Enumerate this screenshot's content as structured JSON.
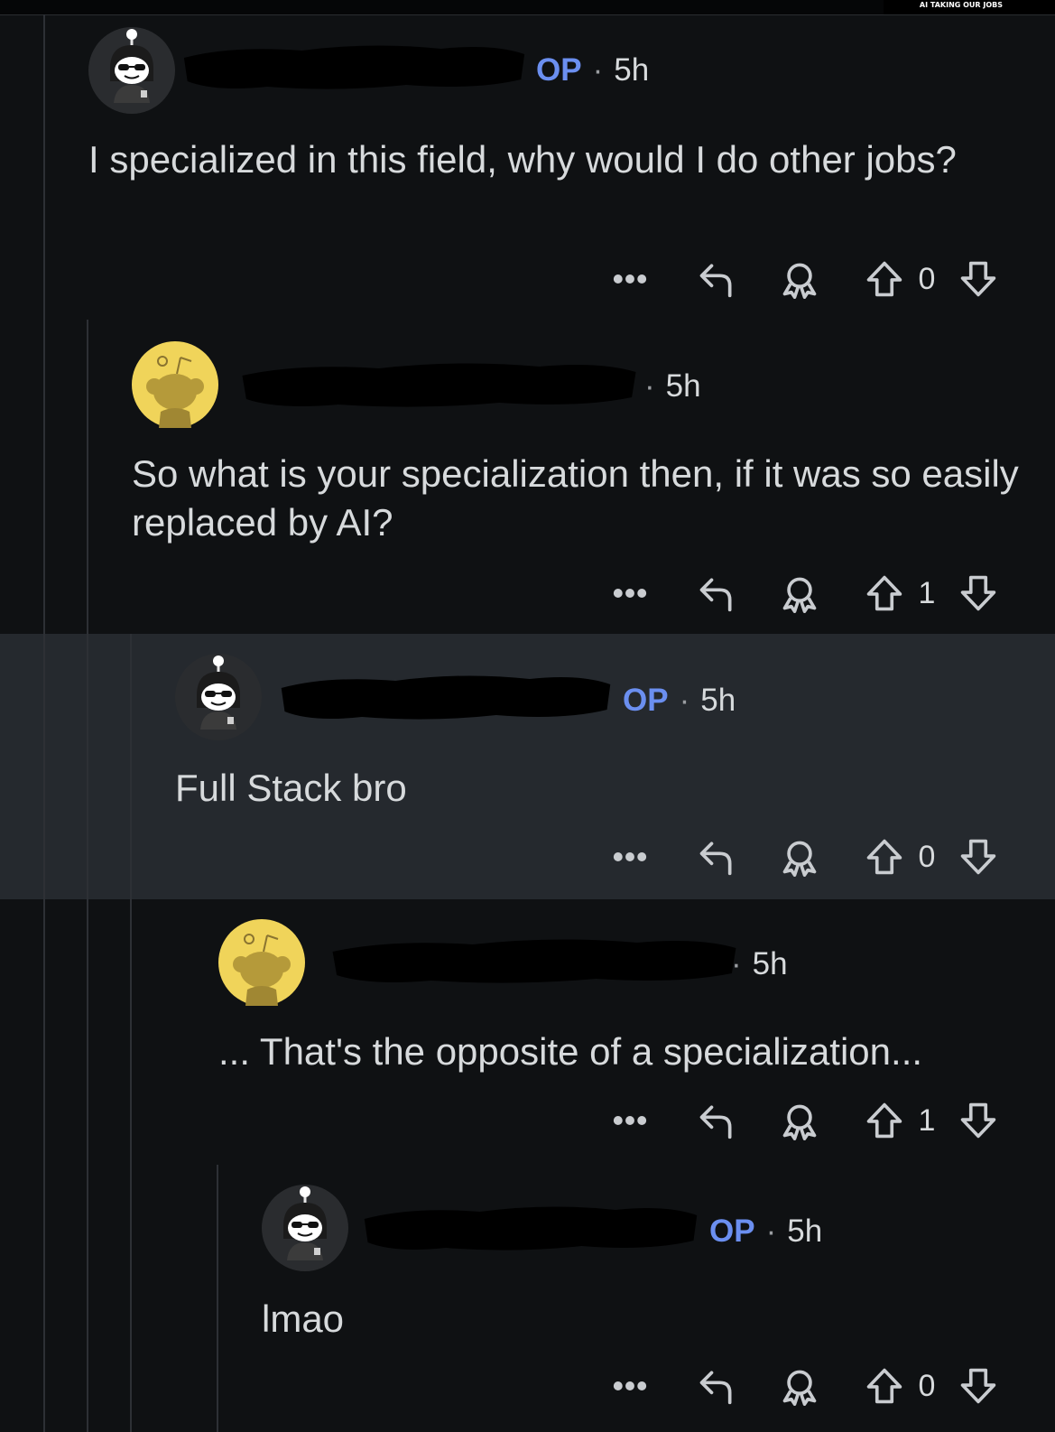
{
  "watermark": {
    "text": "AI TAKING OUR JOBS"
  },
  "comments": [
    {
      "op": "OP",
      "dot": "·",
      "time": "5h",
      "body": "I specialized in this field, why would I do other jobs?",
      "votes": "0"
    },
    {
      "dot": "·",
      "time": "5h",
      "body": "So what is your specialization then, if it was so easily replaced by AI?",
      "votes": "1"
    },
    {
      "op": "OP",
      "dot": "·",
      "time": "5h",
      "body": "Full Stack bro",
      "votes": "0"
    },
    {
      "dot": "·",
      "time": "5h",
      "body": "... That's the opposite of a specialization...",
      "votes": "1"
    },
    {
      "op": "OP",
      "dot": "·",
      "time": "5h",
      "body": "lmao",
      "votes": "0"
    }
  ],
  "colors": {
    "background": "#0f1113",
    "highlight": "#25292e",
    "op_label": "#6b8ff0",
    "text": "#d7dadc",
    "icon": "#c9ccd0",
    "snoo_yellow": "#f0d45a"
  },
  "icons": [
    "overflow-menu-icon",
    "reply-icon",
    "award-icon",
    "upvote-icon",
    "downvote-icon"
  ]
}
